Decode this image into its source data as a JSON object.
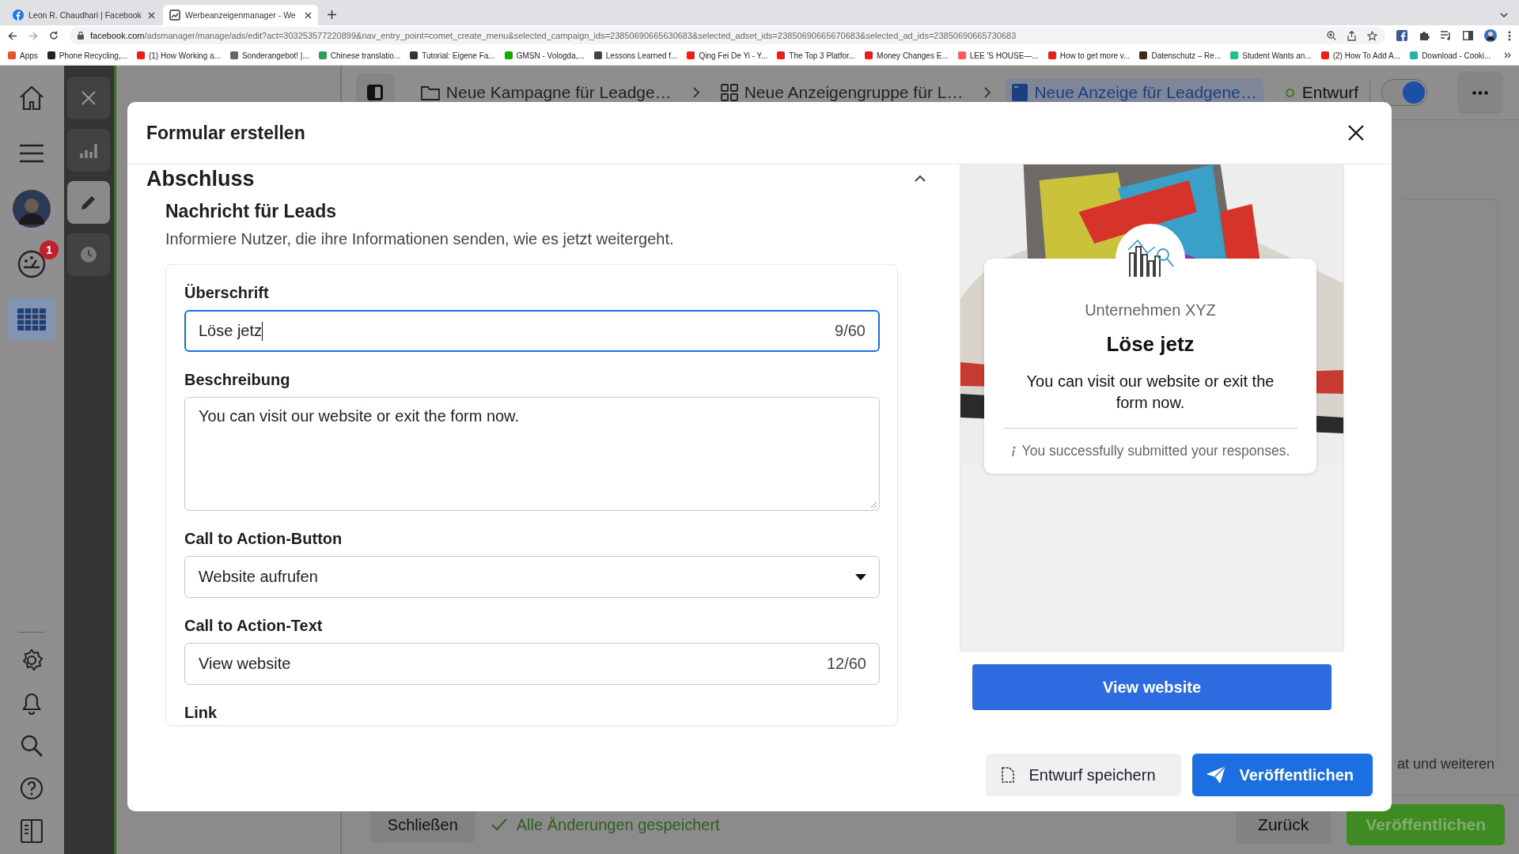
{
  "browser": {
    "tabs": [
      {
        "title": "Leon R. Chaudhari | Facebook",
        "selected": false
      },
      {
        "title": "Werbeanzeigenmanager - We",
        "selected": true
      }
    ],
    "url_host": "facebook.com",
    "url_path": "/adsmanager/manage/ads/edit?act=303253577220899&nav_entry_point=comet_create_menu&selected_campaign_ids=23850690665630683&selected_adset_ids=23850690665670683&selected_ad_ids=23850690665730683",
    "bookmarks": [
      {
        "label": "Apps",
        "color": "#e4572e"
      },
      {
        "label": "Phone Recycling,...",
        "color": "#222222"
      },
      {
        "label": "(1) How Working a...",
        "color": "#e62117"
      },
      {
        "label": "Sonderangebot! |...",
        "color": "#666666"
      },
      {
        "label": "Chinese translatio...",
        "color": "#2e9e5b"
      },
      {
        "label": "Tutorial: Eigene Fa...",
        "color": "#333333"
      },
      {
        "label": "GMSN - Vologda,...",
        "color": "#14a800"
      },
      {
        "label": "Lessons Learned f...",
        "color": "#444444"
      },
      {
        "label": "Qing Fei De Yi - Y...",
        "color": "#e62117"
      },
      {
        "label": "The Top 3 Platfor...",
        "color": "#e62117"
      },
      {
        "label": "Money Changes E...",
        "color": "#e62117"
      },
      {
        "label": "LEE 'S HOUSE—...",
        "color": "#ff5a5f"
      },
      {
        "label": "How to get more v...",
        "color": "#e62117"
      },
      {
        "label": "Datenschutz – Re...",
        "color": "#3a2a1a"
      },
      {
        "label": "Student Wants an...",
        "color": "#21c08b"
      },
      {
        "label": "(2) How To Add A...",
        "color": "#e62117"
      },
      {
        "label": "Download - Cooki...",
        "color": "#1fb6a6"
      }
    ]
  },
  "rail": {
    "notification_count": "1",
    "items": [
      {
        "kind": "home",
        "selected": false
      },
      {
        "kind": "menu",
        "selected": false
      },
      {
        "kind": "avatar",
        "selected": false
      },
      {
        "kind": "palette",
        "selected": false
      },
      {
        "kind": "grid",
        "selected": true
      }
    ],
    "bottom_items": [
      {
        "kind": "gear"
      },
      {
        "kind": "bell"
      },
      {
        "kind": "search"
      },
      {
        "kind": "help"
      },
      {
        "kind": "panel"
      }
    ]
  },
  "tools": [
    {
      "kind": "close",
      "selected": false
    },
    {
      "kind": "chart",
      "selected": false
    },
    {
      "kind": "pencil",
      "selected": true
    },
    {
      "kind": "clock",
      "selected": false
    }
  ],
  "breadcrumb": [
    {
      "kind": "folder",
      "label": "Neue Kampagne für Leadge…",
      "selected": false
    },
    {
      "kind": "grid",
      "label": "Neue Anzeigengruppe für L…",
      "selected": false
    },
    {
      "kind": "ad",
      "label": "Neue Anzeige für Leadgene…",
      "selected": true
    }
  ],
  "status": {
    "label": "Entwurf",
    "toggle_on": true
  },
  "background_text": "at und weiteren",
  "bottom_bar": {
    "close": "Schließen",
    "saved": "Alle Änderungen gespeichert",
    "back": "Zurück",
    "publish": "Veröffentlichen"
  },
  "modal": {
    "title": "Formular erstellen",
    "section": {
      "title": "Abschluss",
      "expanded": true
    },
    "subtitle": "Nachricht für Leads",
    "description": "Informiere Nutzer, die ihre Informationen senden, wie es jetzt weitergeht.",
    "fields": [
      {
        "kind": "text",
        "label": "Überschrift",
        "value": "Löse jetz",
        "counter": "9/60",
        "focused": true
      },
      {
        "kind": "textarea",
        "label": "Beschreibung",
        "value": "You can visit our website or exit the form now.",
        "focused": false
      },
      {
        "kind": "select",
        "label": "Call to Action-Button",
        "value": "Website aufrufen",
        "focused": false
      },
      {
        "kind": "text",
        "label": "Call to Action-Text",
        "value": "View website",
        "counter": "12/60",
        "focused": false
      }
    ],
    "next_label": "Link",
    "preview": {
      "kind": "picture",
      "company": "Unternehmen XYZ",
      "headline": "Löse jetz",
      "body": "You can visit our website or exit the form now.",
      "note": "You successfully submitted your responses.",
      "button": "View website"
    },
    "buttons": [
      {
        "kind": "secondary",
        "label": "Entwurf speichern"
      },
      {
        "kind": "primary",
        "label": "Veröffentlichen"
      }
    ]
  }
}
